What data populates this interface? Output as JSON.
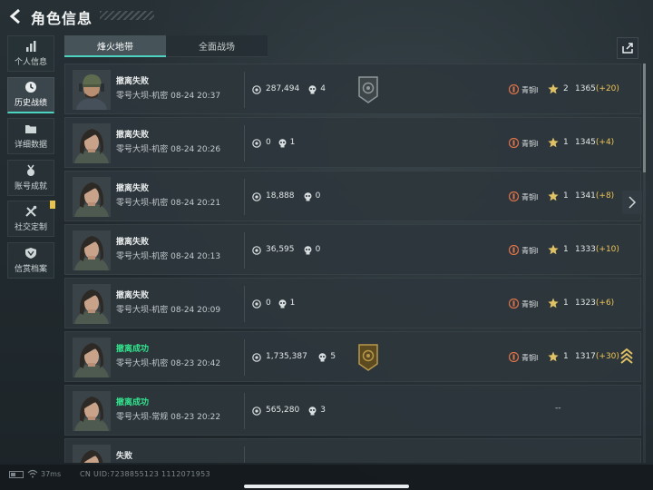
{
  "header": {
    "title": "角色信息"
  },
  "sidebar": {
    "items": [
      {
        "label": "个人信息",
        "icon": "bar-chart-icon",
        "active": false,
        "badge": false
      },
      {
        "label": "历史战绩",
        "icon": "clock-icon",
        "active": true,
        "badge": false
      },
      {
        "label": "详细数据",
        "icon": "folder-icon",
        "active": false,
        "badge": false
      },
      {
        "label": "账号成就",
        "icon": "medal-icon",
        "active": false,
        "badge": false
      },
      {
        "label": "社交定制",
        "icon": "tools-icon",
        "active": false,
        "badge": true
      },
      {
        "label": "信赏档案",
        "icon": "shield-icon",
        "active": false,
        "badge": false
      }
    ]
  },
  "tabs": [
    {
      "label": "烽火地带",
      "active": true
    },
    {
      "label": "全面战场",
      "active": false
    }
  ],
  "share": {
    "icon": "share-icon"
  },
  "rows": [
    {
      "status": "撤离失败",
      "success": false,
      "map": "零号大坝-机密",
      "time": "08-24 20:37",
      "value": "287,494",
      "kills": "4",
      "emblem": "silver",
      "rank": "青铜I",
      "stars": "2",
      "points": "1365",
      "delta": "(+20)",
      "arrows": false,
      "avatar": "cap"
    },
    {
      "status": "撤离失败",
      "success": false,
      "map": "零号大坝-机密",
      "time": "08-24 20:26",
      "value": "0",
      "kills": "1",
      "emblem": "",
      "rank": "青铜I",
      "stars": "1",
      "points": "1345",
      "delta": "(+4)",
      "arrows": false,
      "avatar": "hair"
    },
    {
      "status": "撤离失败",
      "success": false,
      "map": "零号大坝-机密",
      "time": "08-24 20:21",
      "value": "18,888",
      "kills": "0",
      "emblem": "",
      "rank": "青铜I",
      "stars": "1",
      "points": "1341",
      "delta": "(+8)",
      "arrows": false,
      "avatar": "hair"
    },
    {
      "status": "撤离失败",
      "success": false,
      "map": "零号大坝-机密",
      "time": "08-24 20:13",
      "value": "36,595",
      "kills": "0",
      "emblem": "",
      "rank": "青铜I",
      "stars": "1",
      "points": "1333",
      "delta": "(+10)",
      "arrows": false,
      "avatar": "hair"
    },
    {
      "status": "撤离失败",
      "success": false,
      "map": "零号大坝-机密",
      "time": "08-24 20:09",
      "value": "0",
      "kills": "1",
      "emblem": "",
      "rank": "青铜I",
      "stars": "1",
      "points": "1323",
      "delta": "(+6)",
      "arrows": false,
      "avatar": "hair"
    },
    {
      "status": "撤离成功",
      "success": true,
      "map": "零号大坝-机密",
      "time": "08-23 20:42",
      "value": "1,735,387",
      "kills": "5",
      "emblem": "gold",
      "rank": "青铜I",
      "stars": "1",
      "points": "1317",
      "delta": "(+30)",
      "arrows": true,
      "avatar": "hair"
    },
    {
      "status": "撤离成功",
      "success": true,
      "map": "零号大坝-常规",
      "time": "08-23 20:22",
      "value": "565,280",
      "kills": "3",
      "emblem": "",
      "rank": "",
      "stars": "",
      "points": "--",
      "delta": "",
      "arrows": false,
      "avatar": "hair"
    },
    {
      "status": "失败",
      "success": false,
      "map": "",
      "time": "",
      "value": "",
      "kills": "",
      "emblem": "",
      "rank": "",
      "stars": "",
      "points": "",
      "delta": "",
      "arrows": false,
      "avatar": "hair"
    }
  ],
  "footer": {
    "ping": "37ms",
    "uid": "CN UID:7238855123 1112071953"
  },
  "colors": {
    "accent": "#4dd4c0",
    "success": "#33e38d",
    "delta": "#f0c658",
    "rank": "#d9714a"
  }
}
